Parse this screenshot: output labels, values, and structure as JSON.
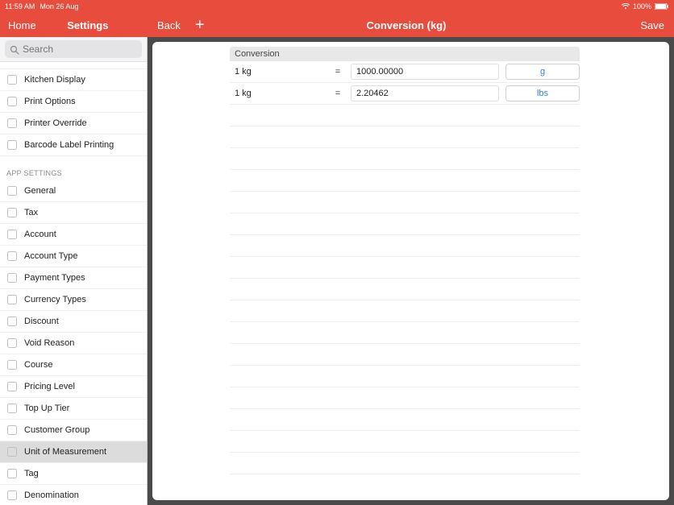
{
  "status": {
    "time": "11:59 AM",
    "date": "Mon 26 Aug",
    "battery": "100%"
  },
  "topbar": {
    "home": "Home",
    "settings": "Settings",
    "back": "Back",
    "title": "Conversion (kg)",
    "save": "Save"
  },
  "search": {
    "placeholder": "Search"
  },
  "sidebar": {
    "group1": [
      {
        "label": "Kitchen Display"
      },
      {
        "label": "Print Options"
      },
      {
        "label": "Printer Override"
      },
      {
        "label": "Barcode Label Printing"
      }
    ],
    "section2_header": "APP SETTINGS",
    "group2": [
      {
        "label": "General"
      },
      {
        "label": "Tax"
      },
      {
        "label": "Account"
      },
      {
        "label": "Account Type"
      },
      {
        "label": "Payment Types"
      },
      {
        "label": "Currency Types"
      },
      {
        "label": "Discount"
      },
      {
        "label": "Void Reason"
      },
      {
        "label": "Course"
      },
      {
        "label": "Pricing Level"
      },
      {
        "label": "Top Up Tier"
      },
      {
        "label": "Customer Group"
      },
      {
        "label": "Unit of Measurement"
      },
      {
        "label": "Tag"
      },
      {
        "label": "Denomination"
      }
    ],
    "selected_label": "Unit of Measurement"
  },
  "table": {
    "header": "Conversion",
    "rows": [
      {
        "from": "1 kg",
        "eq": "=",
        "value": "1000.00000",
        "to": "g"
      },
      {
        "from": "1 kg",
        "eq": "=",
        "value": "2.20462",
        "to": "lbs"
      }
    ]
  }
}
